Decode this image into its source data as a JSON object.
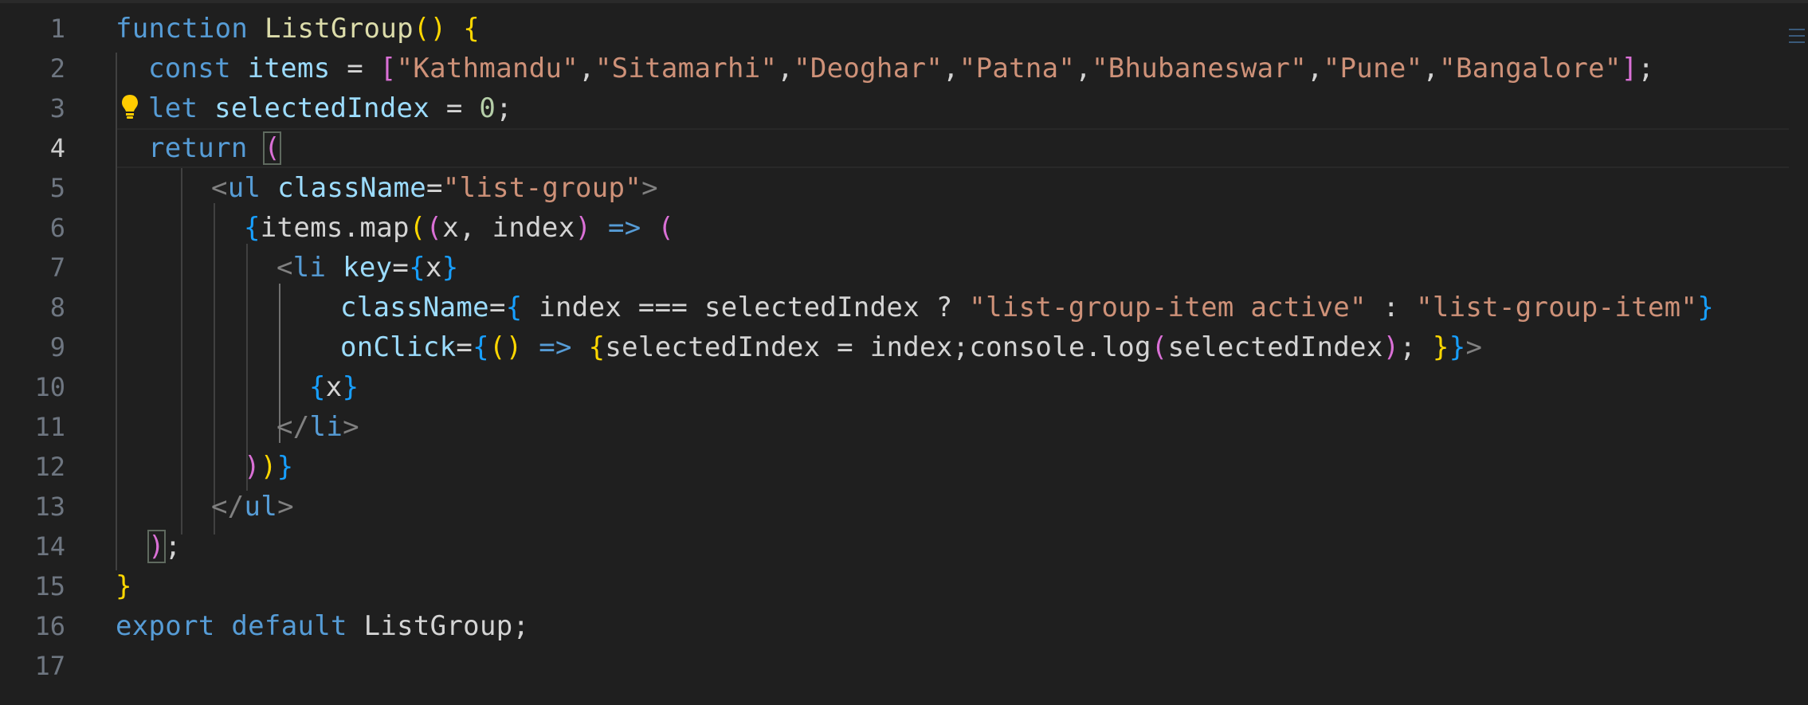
{
  "editor": {
    "active_line": 4,
    "lines": [
      {
        "n": "1"
      },
      {
        "n": "2"
      },
      {
        "n": "3"
      },
      {
        "n": "4"
      },
      {
        "n": "5"
      },
      {
        "n": "6"
      },
      {
        "n": "7"
      },
      {
        "n": "8"
      },
      {
        "n": "9"
      },
      {
        "n": "10"
      },
      {
        "n": "11"
      },
      {
        "n": "12"
      },
      {
        "n": "13"
      },
      {
        "n": "14"
      },
      {
        "n": "15"
      },
      {
        "n": "16"
      },
      {
        "n": "17"
      }
    ],
    "tokens": {
      "l1": [
        "function",
        " ListGroup",
        "()",
        " {"
      ],
      "l2": [
        "const",
        " items",
        " = ",
        "[",
        "\"Kathmandu\"",
        ",",
        "\"Sitamarhi\"",
        ",",
        "\"Deoghar\"",
        ",",
        "\"Patna\"",
        ",",
        "\"Bhubaneswar\"",
        ",",
        "\"Pune\"",
        ",",
        "\"Bangalore\"",
        "]",
        ";"
      ],
      "l3": [
        "let",
        " selectedIndex",
        " = ",
        "0",
        ";"
      ],
      "l4": [
        "return",
        " ",
        "("
      ],
      "l5": [
        "<",
        "ul",
        " className",
        "=",
        "\"list-group\"",
        ">"
      ],
      "l6": [
        "{",
        "items",
        ".",
        "map",
        "(",
        "(",
        "x",
        ", ",
        "index",
        ")",
        " => ",
        "("
      ],
      "l7": [
        "<",
        "li",
        " key",
        "=",
        "{",
        "x",
        "}"
      ],
      "l8": [
        "className",
        "=",
        "{",
        " index === selectedIndex ? ",
        "\"list-group-item active\"",
        " : ",
        "\"list-group-item\"",
        "}"
      ],
      "l9": [
        "onClick",
        "=",
        "{",
        "(",
        ")",
        " => ",
        "{",
        "selectedIndex = index;console.",
        "log",
        "(",
        "selectedIndex",
        ")",
        "; ",
        "}",
        "}",
        ">"
      ],
      "l10": [
        "{",
        "x",
        "}"
      ],
      "l11": [
        "</",
        "li",
        ">"
      ],
      "l12": [
        ")",
        ")",
        "}"
      ],
      "l13": [
        "</",
        "ul",
        ">"
      ],
      "l14": [
        ")",
        ";"
      ],
      "l15": [
        "}"
      ],
      "l16": [
        "export",
        " default",
        " ListGroup",
        ";"
      ],
      "l17": []
    }
  },
  "icons": {
    "lightbulb": "lightbulb-icon"
  },
  "colors": {
    "background": "#1f1f1f",
    "keyword": "#569cd6",
    "string": "#ce9178",
    "bracket1": "#ffd700",
    "bracket2": "#da70d6",
    "bracket3": "#179fff",
    "lightbulb": "#ffcc00"
  }
}
